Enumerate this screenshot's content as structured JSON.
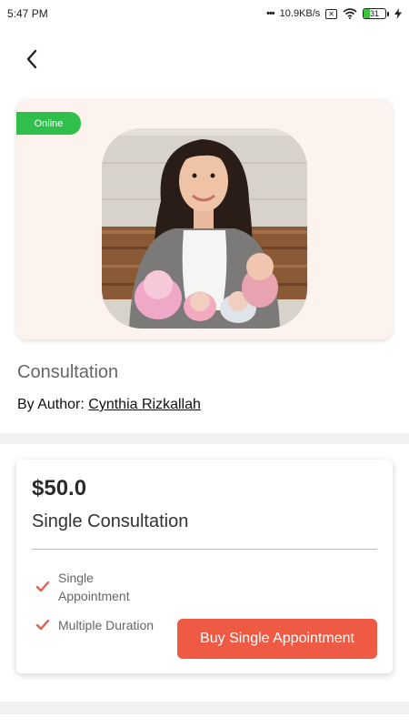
{
  "status_bar": {
    "time": "5:47 PM",
    "network_speed": "10.9KB/s",
    "battery_level": "31",
    "battery_percent": 31
  },
  "hero": {
    "badge": "Online",
    "photo_alt": "Consultant photo"
  },
  "product": {
    "title": "Consultation",
    "author_prefix": "By Author: ",
    "author_name": "Cynthia Rizkallah"
  },
  "plan": {
    "price": "$50.0",
    "name": "Single Consultation",
    "features": [
      "Single Appointment",
      "Multiple Duration"
    ],
    "buy_label": "Buy Single Appointment"
  },
  "colors": {
    "accent": "#ef5a45",
    "online": "#2fbf4b",
    "hero_bg": "#fdf3ee"
  },
  "icons": {
    "back": "chevron-left-icon",
    "check": "check-icon"
  }
}
